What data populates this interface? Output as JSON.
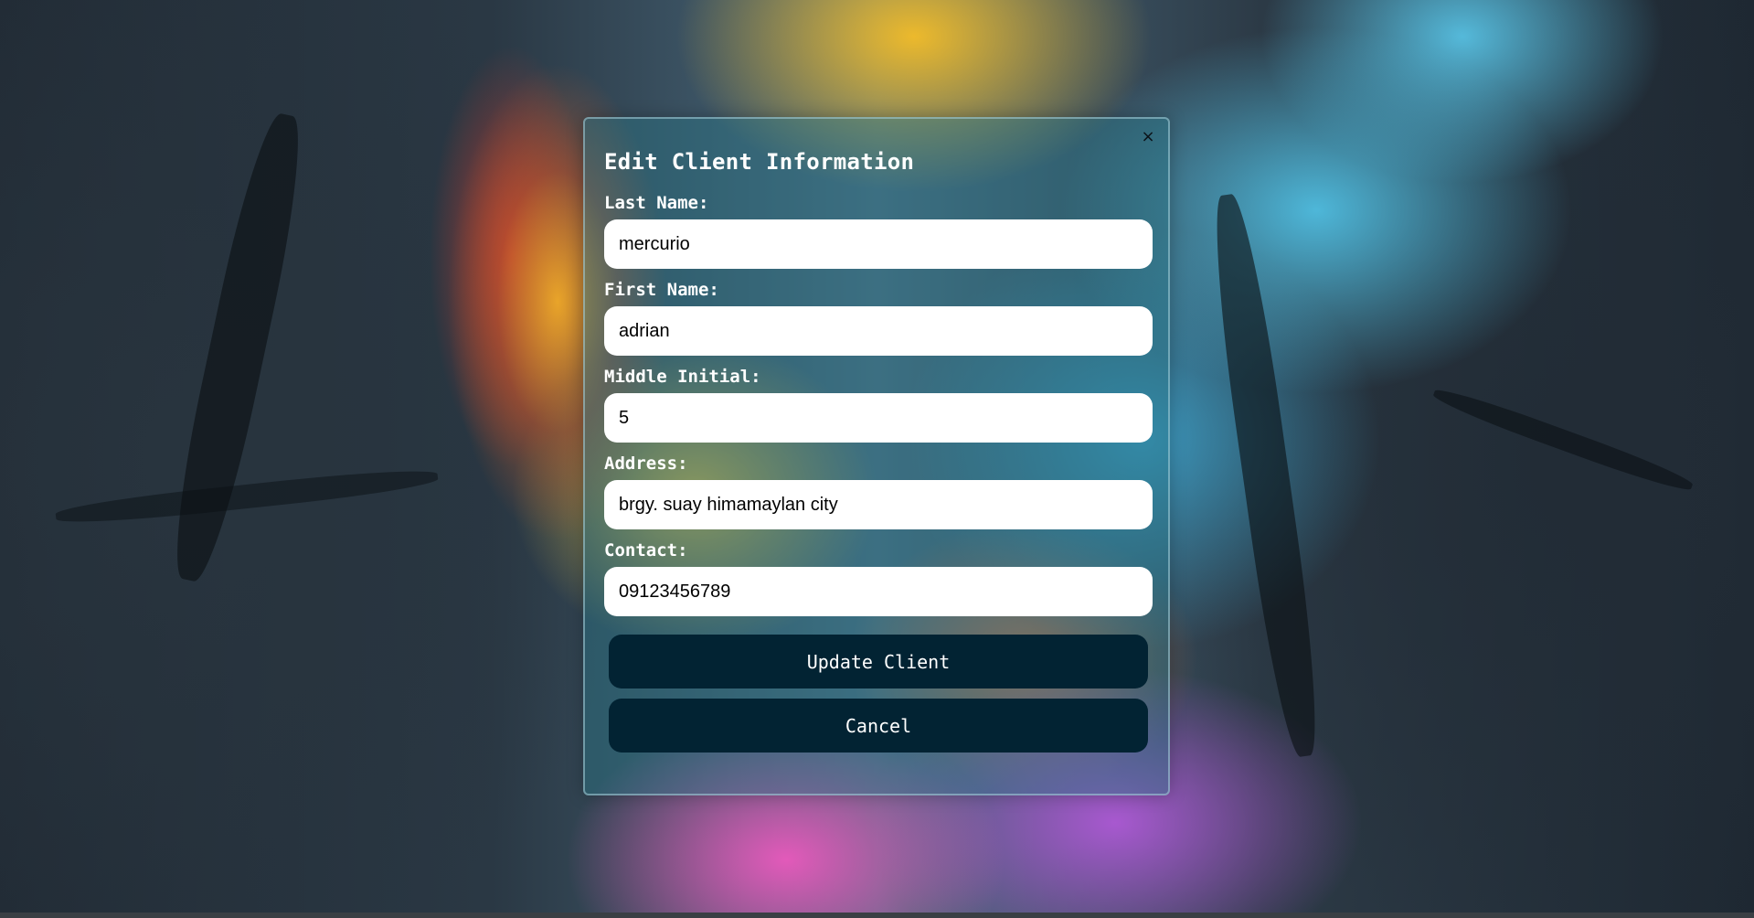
{
  "modal": {
    "title": "Edit Client Information",
    "close_glyph": "×",
    "close_icon": "close-icon"
  },
  "fields": {
    "last_name": {
      "label": "Last Name:",
      "value": "mercurio"
    },
    "first_name": {
      "label": "First Name:",
      "value": "adrian"
    },
    "middle_initial": {
      "label": "Middle Initial:",
      "value": "5"
    },
    "address": {
      "label": "Address:",
      "value": "brgy. suay himamaylan city"
    },
    "contact": {
      "label": "Contact:",
      "value": "09123456789"
    }
  },
  "buttons": {
    "update": "Update Client",
    "cancel": "Cancel"
  },
  "colors": {
    "button_bg": "#022333",
    "modal_tint": "rgba(40,120,135,0.42)"
  }
}
